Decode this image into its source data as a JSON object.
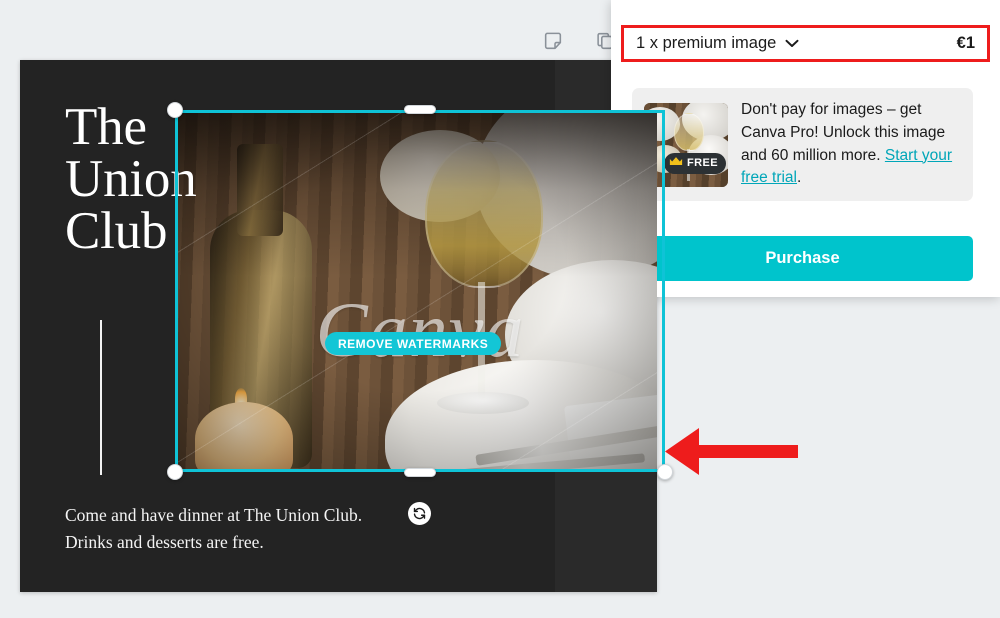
{
  "toolbar": {
    "items": [
      {
        "name": "notes-icon",
        "label": "Notes"
      },
      {
        "name": "duplicate-icon",
        "label": "Duplicate page"
      }
    ]
  },
  "design": {
    "title_lines": [
      "The",
      "Union",
      "Club"
    ],
    "body_lines": [
      "Come and have dinner at The Union Club.",
      "Drinks and desserts are free."
    ],
    "watermark_text": "Canva",
    "sync_icon": "sync-icon",
    "background_color": "#232323",
    "text_color": "#ffffff"
  },
  "selection": {
    "accent_color": "#0fc3d6",
    "remove_watermarks_label": "REMOVE WATERMARKS",
    "handles": [
      "top-left",
      "top-center",
      "bottom-left",
      "bottom-center",
      "bottom-right"
    ]
  },
  "annotation": {
    "arrow_color": "#ee1c1c",
    "arrow_direction": "left",
    "highlight_border_color": "#ee1c1c"
  },
  "purchase_panel": {
    "line_item": {
      "label": "1 x premium image",
      "chevron": "chevron-down-icon",
      "price": "€1"
    },
    "promo": {
      "thumbnail_badge": {
        "crown_icon": "crown-icon",
        "label": "FREE"
      },
      "text_before_link": "Don't pay for images – get Canva Pro! Unlock this image and 60 million more. ",
      "link_text": "Start your free trial",
      "text_after_link": "."
    },
    "purchase_button_label": "Purchase",
    "accent_color": "#00c4cc"
  }
}
